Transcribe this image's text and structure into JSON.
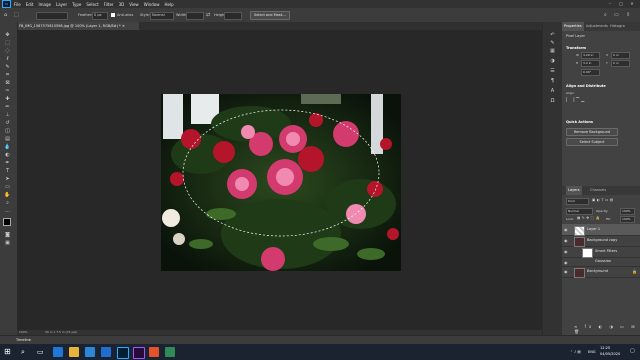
{
  "menu": {
    "items": [
      "File",
      "Edit",
      "Image",
      "Layer",
      "Type",
      "Select",
      "Filter",
      "3D",
      "View",
      "Window",
      "Help"
    ],
    "window_controls": [
      "–",
      "□",
      "✕"
    ]
  },
  "options_bar": {
    "feather_label": "Feather:",
    "feather_value": "0 px",
    "antialias_label": "Anti-alias",
    "style_label": "Style:",
    "style_value": "Normal",
    "width_label": "Width:",
    "height_label": "Height:",
    "select_mask_label": "Select and Mask..."
  },
  "document": {
    "tab_title": "FB_IMG_1587575615598.jpg @ 100% (Layer 1, RGB/8#) *"
  },
  "status": {
    "zoom": "100%",
    "doc_size": "30 in x 7.5 in (72 ppi)"
  },
  "timeline": {
    "label": "Timeline"
  },
  "properties_panel": {
    "tabs": [
      "Properties",
      "Adjustments",
      "Histogra"
    ],
    "layer_type": "Pixel Layer",
    "transform_title": "Transform",
    "w_label": "W",
    "w_value": "4.29 in",
    "h_label": "H",
    "h_value": "3.0 in",
    "x_label": "X",
    "x_value": "0 in",
    "y_label": "Y",
    "y_value": "0 in",
    "angle_value": "0.00°",
    "align_title": "Align and Distribute",
    "align_label": "Align:",
    "quick_actions_title": "Quick Actions",
    "remove_bg_label": "Remove Background",
    "select_subject_label": "Select Subject"
  },
  "layers_panel": {
    "tabs": [
      "Layers",
      "Channels"
    ],
    "kind_label": "Kind",
    "blend_mode": "Normal",
    "opacity_label": "Opacity:",
    "opacity_value": "100%",
    "lock_label": "Lock:",
    "fill_label": "Fill:",
    "fill_value": "100%",
    "layers": [
      {
        "name": "Layer 1",
        "selected": true
      },
      {
        "name": "Background copy",
        "selected": false
      },
      {
        "name": "Smart Filters",
        "selected": false
      },
      {
        "name": "Gaussian",
        "selected": false
      },
      {
        "name": "Background",
        "selected": false
      }
    ]
  },
  "taskbar": {
    "time": "12:25",
    "date": "04/05/2020",
    "lang": "ENG"
  },
  "colors": {
    "accent": "#31a8ff",
    "selected_layer": "#5a5a5a"
  }
}
